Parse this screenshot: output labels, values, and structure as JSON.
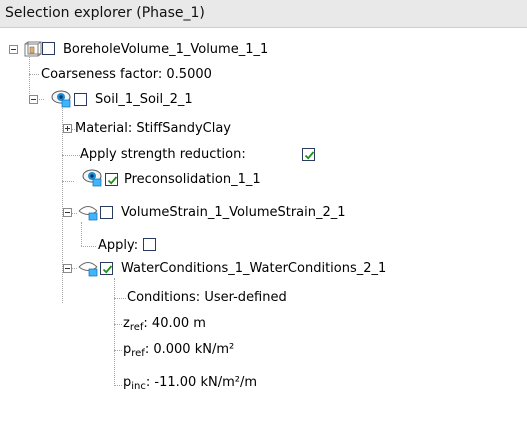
{
  "panel": {
    "title": "Selection explorer (Phase_1)"
  },
  "tree": {
    "root": {
      "label": "BoreholeVolume_1_Volume_1_1",
      "checked": false,
      "icon": "volume-icon"
    },
    "coarseness": {
      "label": "Coarseness factor: 0.5000"
    },
    "soil": {
      "label": "Soil_1_Soil_2_1",
      "checked": false,
      "icon": "eye-icon"
    },
    "material": {
      "label": "Material: StiffSandyClay"
    },
    "strength": {
      "label": "Apply strength reduction:",
      "checked": true
    },
    "precons": {
      "label": "Preconsolidation_1_1",
      "checked": true,
      "icon": "eye-icon"
    },
    "volstrain": {
      "label": "VolumeStrain_1_VolumeStrain_2_1",
      "checked": false,
      "icon": "hidden-eye-icon"
    },
    "apply": {
      "label": "Apply:",
      "checked": false
    },
    "water": {
      "label": "WaterConditions_1_WaterConditions_2_1",
      "checked": true,
      "icon": "hidden-eye-icon"
    },
    "conditions": {
      "label": "Conditions: User-defined"
    },
    "zref": {
      "sym": "z",
      "sub": "ref",
      "value": ": 40.00 m"
    },
    "pref": {
      "sym": "p",
      "sub": "ref",
      "value": ": 0.000 kN/m²"
    },
    "pinc": {
      "sym": "p",
      "sub": "inc",
      "value": ": -11.00 kN/m²/m"
    }
  },
  "colors": {
    "checkmark": "#1f8f1f",
    "eye": "#1e8fd6",
    "checkbox_border": "#2b3a63"
  }
}
